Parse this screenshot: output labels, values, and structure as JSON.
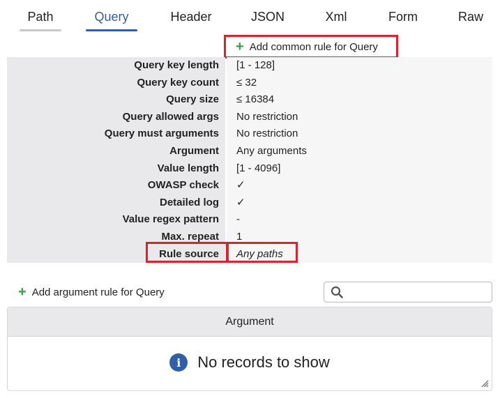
{
  "tabs": [
    {
      "label": "Path",
      "active": false
    },
    {
      "label": "Query",
      "active": true
    },
    {
      "label": "Header",
      "active": false
    },
    {
      "label": "JSON",
      "active": false
    },
    {
      "label": "Xml",
      "active": false
    },
    {
      "label": "Form",
      "active": false
    },
    {
      "label": "Raw",
      "active": false
    }
  ],
  "common_rule": {
    "add_label": "Add common rule for Query",
    "rows": [
      {
        "label": "Query key length",
        "value": "[1 - 128]"
      },
      {
        "label": "Query key count",
        "value": "≤ 32"
      },
      {
        "label": "Query size",
        "value": "≤ 16384"
      },
      {
        "label": "Query allowed args",
        "value": "No restriction"
      },
      {
        "label": "Query must arguments",
        "value": "No restriction"
      },
      {
        "label": "Argument",
        "value": "Any arguments"
      },
      {
        "label": "Value length",
        "value": "[1 - 4096]"
      },
      {
        "label": "OWASP check",
        "value": "✓"
      },
      {
        "label": "Detailed log",
        "value": "✓"
      },
      {
        "label": "Value regex pattern",
        "value": "-"
      },
      {
        "label": "Max. repeat",
        "value": "1"
      },
      {
        "label": "Rule source",
        "value": "Any paths"
      }
    ]
  },
  "argument_rules": {
    "add_label": "Add argument rule for Query",
    "search": {
      "placeholder": "",
      "value": ""
    },
    "column_header": "Argument",
    "empty_message": "No records to show"
  },
  "colors": {
    "accent": "#2f5fa6",
    "highlight": "#e0202a",
    "add_plus": "#27a844",
    "inactive_tab_underline": "#c8c8c8"
  }
}
